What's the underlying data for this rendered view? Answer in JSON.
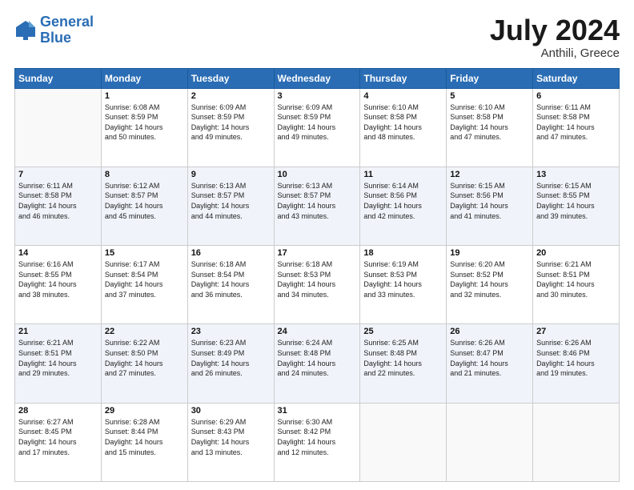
{
  "header": {
    "logo_general": "General",
    "logo_blue": "Blue",
    "title": "July 2024",
    "subtitle": "Anthili, Greece"
  },
  "days_of_week": [
    "Sunday",
    "Monday",
    "Tuesday",
    "Wednesday",
    "Thursday",
    "Friday",
    "Saturday"
  ],
  "weeks": [
    [
      {
        "day": "",
        "info": ""
      },
      {
        "day": "1",
        "info": "Sunrise: 6:08 AM\nSunset: 8:59 PM\nDaylight: 14 hours\nand 50 minutes."
      },
      {
        "day": "2",
        "info": "Sunrise: 6:09 AM\nSunset: 8:59 PM\nDaylight: 14 hours\nand 49 minutes."
      },
      {
        "day": "3",
        "info": "Sunrise: 6:09 AM\nSunset: 8:59 PM\nDaylight: 14 hours\nand 49 minutes."
      },
      {
        "day": "4",
        "info": "Sunrise: 6:10 AM\nSunset: 8:58 PM\nDaylight: 14 hours\nand 48 minutes."
      },
      {
        "day": "5",
        "info": "Sunrise: 6:10 AM\nSunset: 8:58 PM\nDaylight: 14 hours\nand 47 minutes."
      },
      {
        "day": "6",
        "info": "Sunrise: 6:11 AM\nSunset: 8:58 PM\nDaylight: 14 hours\nand 47 minutes."
      }
    ],
    [
      {
        "day": "7",
        "info": "Sunrise: 6:11 AM\nSunset: 8:58 PM\nDaylight: 14 hours\nand 46 minutes."
      },
      {
        "day": "8",
        "info": "Sunrise: 6:12 AM\nSunset: 8:57 PM\nDaylight: 14 hours\nand 45 minutes."
      },
      {
        "day": "9",
        "info": "Sunrise: 6:13 AM\nSunset: 8:57 PM\nDaylight: 14 hours\nand 44 minutes."
      },
      {
        "day": "10",
        "info": "Sunrise: 6:13 AM\nSunset: 8:57 PM\nDaylight: 14 hours\nand 43 minutes."
      },
      {
        "day": "11",
        "info": "Sunrise: 6:14 AM\nSunset: 8:56 PM\nDaylight: 14 hours\nand 42 minutes."
      },
      {
        "day": "12",
        "info": "Sunrise: 6:15 AM\nSunset: 8:56 PM\nDaylight: 14 hours\nand 41 minutes."
      },
      {
        "day": "13",
        "info": "Sunrise: 6:15 AM\nSunset: 8:55 PM\nDaylight: 14 hours\nand 39 minutes."
      }
    ],
    [
      {
        "day": "14",
        "info": "Sunrise: 6:16 AM\nSunset: 8:55 PM\nDaylight: 14 hours\nand 38 minutes."
      },
      {
        "day": "15",
        "info": "Sunrise: 6:17 AM\nSunset: 8:54 PM\nDaylight: 14 hours\nand 37 minutes."
      },
      {
        "day": "16",
        "info": "Sunrise: 6:18 AM\nSunset: 8:54 PM\nDaylight: 14 hours\nand 36 minutes."
      },
      {
        "day": "17",
        "info": "Sunrise: 6:18 AM\nSunset: 8:53 PM\nDaylight: 14 hours\nand 34 minutes."
      },
      {
        "day": "18",
        "info": "Sunrise: 6:19 AM\nSunset: 8:53 PM\nDaylight: 14 hours\nand 33 minutes."
      },
      {
        "day": "19",
        "info": "Sunrise: 6:20 AM\nSunset: 8:52 PM\nDaylight: 14 hours\nand 32 minutes."
      },
      {
        "day": "20",
        "info": "Sunrise: 6:21 AM\nSunset: 8:51 PM\nDaylight: 14 hours\nand 30 minutes."
      }
    ],
    [
      {
        "day": "21",
        "info": "Sunrise: 6:21 AM\nSunset: 8:51 PM\nDaylight: 14 hours\nand 29 minutes."
      },
      {
        "day": "22",
        "info": "Sunrise: 6:22 AM\nSunset: 8:50 PM\nDaylight: 14 hours\nand 27 minutes."
      },
      {
        "day": "23",
        "info": "Sunrise: 6:23 AM\nSunset: 8:49 PM\nDaylight: 14 hours\nand 26 minutes."
      },
      {
        "day": "24",
        "info": "Sunrise: 6:24 AM\nSunset: 8:48 PM\nDaylight: 14 hours\nand 24 minutes."
      },
      {
        "day": "25",
        "info": "Sunrise: 6:25 AM\nSunset: 8:48 PM\nDaylight: 14 hours\nand 22 minutes."
      },
      {
        "day": "26",
        "info": "Sunrise: 6:26 AM\nSunset: 8:47 PM\nDaylight: 14 hours\nand 21 minutes."
      },
      {
        "day": "27",
        "info": "Sunrise: 6:26 AM\nSunset: 8:46 PM\nDaylight: 14 hours\nand 19 minutes."
      }
    ],
    [
      {
        "day": "28",
        "info": "Sunrise: 6:27 AM\nSunset: 8:45 PM\nDaylight: 14 hours\nand 17 minutes."
      },
      {
        "day": "29",
        "info": "Sunrise: 6:28 AM\nSunset: 8:44 PM\nDaylight: 14 hours\nand 15 minutes."
      },
      {
        "day": "30",
        "info": "Sunrise: 6:29 AM\nSunset: 8:43 PM\nDaylight: 14 hours\nand 13 minutes."
      },
      {
        "day": "31",
        "info": "Sunrise: 6:30 AM\nSunset: 8:42 PM\nDaylight: 14 hours\nand 12 minutes."
      },
      {
        "day": "",
        "info": ""
      },
      {
        "day": "",
        "info": ""
      },
      {
        "day": "",
        "info": ""
      }
    ]
  ]
}
